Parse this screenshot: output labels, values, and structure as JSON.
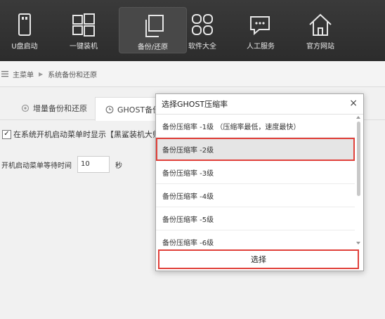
{
  "toolbar": {
    "items": [
      {
        "label": "U盘启动",
        "icon": "usb-drive-icon"
      },
      {
        "label": "一键装机",
        "icon": "windows-icon"
      },
      {
        "label": "备份/还原",
        "icon": "copy-icon"
      },
      {
        "label": "软件大全",
        "icon": "apps-grid-icon"
      },
      {
        "label": "人工服务",
        "icon": "chat-bubble-icon"
      },
      {
        "label": "官方网站",
        "icon": "home-icon"
      }
    ],
    "active_index": 2
  },
  "breadcrumb": {
    "root": "主菜单",
    "separator": "▶",
    "current": "系统备份和还原"
  },
  "tabs": [
    {
      "label": "增量备份和还原",
      "icon": "gear-icon"
    },
    {
      "label": "GHOST备份",
      "icon": "clock-icon"
    }
  ],
  "settings": {
    "show_in_boot_menu_label": "在系统开机启动菜单时显示【黑鲨装机大师 DO",
    "show_in_boot_menu_checked": true,
    "wait_time_label": "开机启动菜单等待时间",
    "wait_time_value": "10",
    "wait_time_unit": "秒"
  },
  "dialog": {
    "title": "选择GHOST压缩率",
    "close": "×",
    "options": [
      "备份压缩率 -1级 （压缩率最低，速度最快）",
      "备份压缩率 -2级",
      "备份压缩率 -3级",
      "备份压缩率 -4级",
      "备份压缩率 -5级",
      "备份压缩率 -6级"
    ],
    "selected_index": 1,
    "confirm_label": "选择"
  },
  "colors": {
    "toolbar_bg": "#2f2f2f",
    "highlight_border": "#e0403a"
  }
}
